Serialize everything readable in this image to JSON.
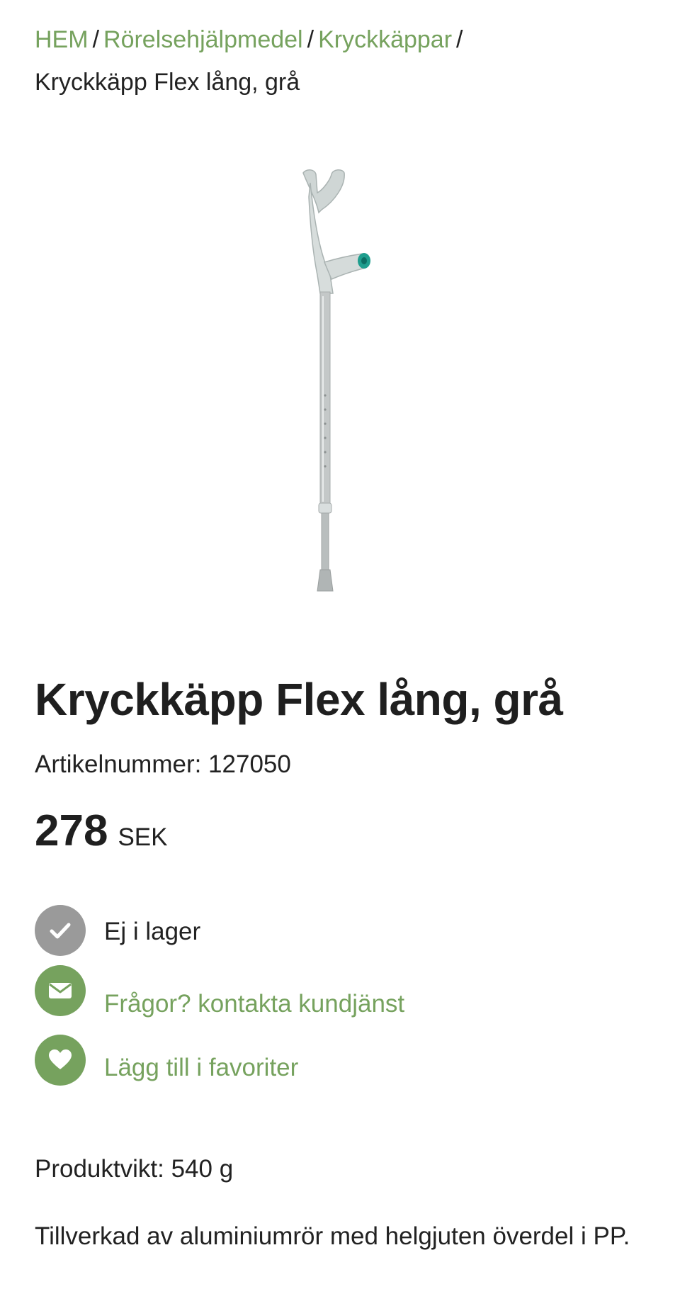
{
  "breadcrumb": {
    "items": [
      "HEM",
      "Rörelsehjälpmedel",
      "Kryckkäppar"
    ],
    "separator": "/",
    "current": "Kryckkäpp Flex lång, grå"
  },
  "product": {
    "image_alt_icon": "crutch-image",
    "title": "Kryckkäpp Flex lång, grå",
    "sku_label": "Artikelnummer: 127050",
    "price": "278",
    "currency": "SEK"
  },
  "status": {
    "stock_label": "Ej i lager",
    "stock_icon": "check-icon",
    "contact_label": "Frågor? kontakta kundjänst",
    "contact_icon": "mail-icon",
    "favorite_label": "Lägg till i favoriter",
    "favorite_icon": "heart-icon"
  },
  "details": {
    "weight": "Produktvikt: 540 g",
    "description": "Tillverkad av aluminiumrör med helgjuten överdel i PP."
  },
  "colors": {
    "accent_green": "#76a25e",
    "stock_gray": "#9a9a9a",
    "grip_teal": "#1f9e8e"
  }
}
